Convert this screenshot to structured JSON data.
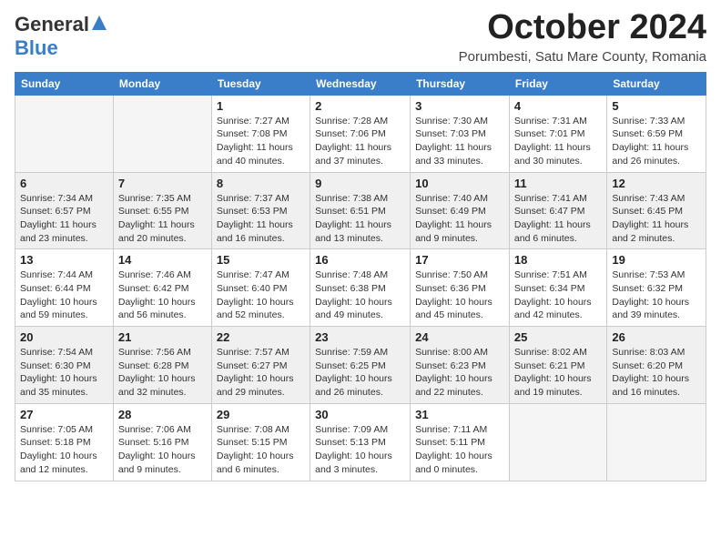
{
  "header": {
    "logo_general": "General",
    "logo_blue": "Blue",
    "month_title": "October 2024",
    "location": "Porumbesti, Satu Mare County, Romania"
  },
  "weekdays": [
    "Sunday",
    "Monday",
    "Tuesday",
    "Wednesday",
    "Thursday",
    "Friday",
    "Saturday"
  ],
  "weeks": [
    [
      {
        "num": "",
        "detail": ""
      },
      {
        "num": "",
        "detail": ""
      },
      {
        "num": "1",
        "detail": "Sunrise: 7:27 AM\nSunset: 7:08 PM\nDaylight: 11 hours and 40 minutes."
      },
      {
        "num": "2",
        "detail": "Sunrise: 7:28 AM\nSunset: 7:06 PM\nDaylight: 11 hours and 37 minutes."
      },
      {
        "num": "3",
        "detail": "Sunrise: 7:30 AM\nSunset: 7:03 PM\nDaylight: 11 hours and 33 minutes."
      },
      {
        "num": "4",
        "detail": "Sunrise: 7:31 AM\nSunset: 7:01 PM\nDaylight: 11 hours and 30 minutes."
      },
      {
        "num": "5",
        "detail": "Sunrise: 7:33 AM\nSunset: 6:59 PM\nDaylight: 11 hours and 26 minutes."
      }
    ],
    [
      {
        "num": "6",
        "detail": "Sunrise: 7:34 AM\nSunset: 6:57 PM\nDaylight: 11 hours and 23 minutes."
      },
      {
        "num": "7",
        "detail": "Sunrise: 7:35 AM\nSunset: 6:55 PM\nDaylight: 11 hours and 20 minutes."
      },
      {
        "num": "8",
        "detail": "Sunrise: 7:37 AM\nSunset: 6:53 PM\nDaylight: 11 hours and 16 minutes."
      },
      {
        "num": "9",
        "detail": "Sunrise: 7:38 AM\nSunset: 6:51 PM\nDaylight: 11 hours and 13 minutes."
      },
      {
        "num": "10",
        "detail": "Sunrise: 7:40 AM\nSunset: 6:49 PM\nDaylight: 11 hours and 9 minutes."
      },
      {
        "num": "11",
        "detail": "Sunrise: 7:41 AM\nSunset: 6:47 PM\nDaylight: 11 hours and 6 minutes."
      },
      {
        "num": "12",
        "detail": "Sunrise: 7:43 AM\nSunset: 6:45 PM\nDaylight: 11 hours and 2 minutes."
      }
    ],
    [
      {
        "num": "13",
        "detail": "Sunrise: 7:44 AM\nSunset: 6:44 PM\nDaylight: 10 hours and 59 minutes."
      },
      {
        "num": "14",
        "detail": "Sunrise: 7:46 AM\nSunset: 6:42 PM\nDaylight: 10 hours and 56 minutes."
      },
      {
        "num": "15",
        "detail": "Sunrise: 7:47 AM\nSunset: 6:40 PM\nDaylight: 10 hours and 52 minutes."
      },
      {
        "num": "16",
        "detail": "Sunrise: 7:48 AM\nSunset: 6:38 PM\nDaylight: 10 hours and 49 minutes."
      },
      {
        "num": "17",
        "detail": "Sunrise: 7:50 AM\nSunset: 6:36 PM\nDaylight: 10 hours and 45 minutes."
      },
      {
        "num": "18",
        "detail": "Sunrise: 7:51 AM\nSunset: 6:34 PM\nDaylight: 10 hours and 42 minutes."
      },
      {
        "num": "19",
        "detail": "Sunrise: 7:53 AM\nSunset: 6:32 PM\nDaylight: 10 hours and 39 minutes."
      }
    ],
    [
      {
        "num": "20",
        "detail": "Sunrise: 7:54 AM\nSunset: 6:30 PM\nDaylight: 10 hours and 35 minutes."
      },
      {
        "num": "21",
        "detail": "Sunrise: 7:56 AM\nSunset: 6:28 PM\nDaylight: 10 hours and 32 minutes."
      },
      {
        "num": "22",
        "detail": "Sunrise: 7:57 AM\nSunset: 6:27 PM\nDaylight: 10 hours and 29 minutes."
      },
      {
        "num": "23",
        "detail": "Sunrise: 7:59 AM\nSunset: 6:25 PM\nDaylight: 10 hours and 26 minutes."
      },
      {
        "num": "24",
        "detail": "Sunrise: 8:00 AM\nSunset: 6:23 PM\nDaylight: 10 hours and 22 minutes."
      },
      {
        "num": "25",
        "detail": "Sunrise: 8:02 AM\nSunset: 6:21 PM\nDaylight: 10 hours and 19 minutes."
      },
      {
        "num": "26",
        "detail": "Sunrise: 8:03 AM\nSunset: 6:20 PM\nDaylight: 10 hours and 16 minutes."
      }
    ],
    [
      {
        "num": "27",
        "detail": "Sunrise: 7:05 AM\nSunset: 5:18 PM\nDaylight: 10 hours and 12 minutes."
      },
      {
        "num": "28",
        "detail": "Sunrise: 7:06 AM\nSunset: 5:16 PM\nDaylight: 10 hours and 9 minutes."
      },
      {
        "num": "29",
        "detail": "Sunrise: 7:08 AM\nSunset: 5:15 PM\nDaylight: 10 hours and 6 minutes."
      },
      {
        "num": "30",
        "detail": "Sunrise: 7:09 AM\nSunset: 5:13 PM\nDaylight: 10 hours and 3 minutes."
      },
      {
        "num": "31",
        "detail": "Sunrise: 7:11 AM\nSunset: 5:11 PM\nDaylight: 10 hours and 0 minutes."
      },
      {
        "num": "",
        "detail": ""
      },
      {
        "num": "",
        "detail": ""
      }
    ]
  ]
}
